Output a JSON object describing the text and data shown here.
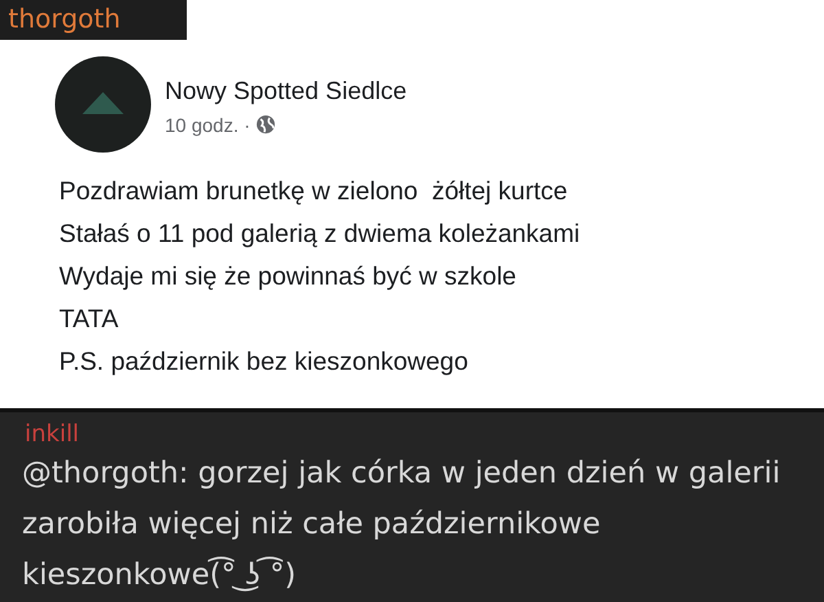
{
  "top_user": "thorgoth",
  "post": {
    "page_name": "Nowy Spotted Siedlce",
    "time": "10 godz. ·",
    "lines": [
      "Pozdrawiam brunetkę w zielono  żółtej kurtce",
      "Stałaś o 11 pod galerią z dwiema koleżankami",
      "Wydaje mi się że powinnaś być w szkole",
      "TATA",
      "P.S. październik bez kieszonkowego"
    ]
  },
  "comment": {
    "author": "inkill",
    "text": "@thorgoth: gorzej jak córka w jeden dzień w galerii zarobiła więcej niż całe październikowe kieszonkowe(͡° ͜ʖ ͡°)"
  }
}
